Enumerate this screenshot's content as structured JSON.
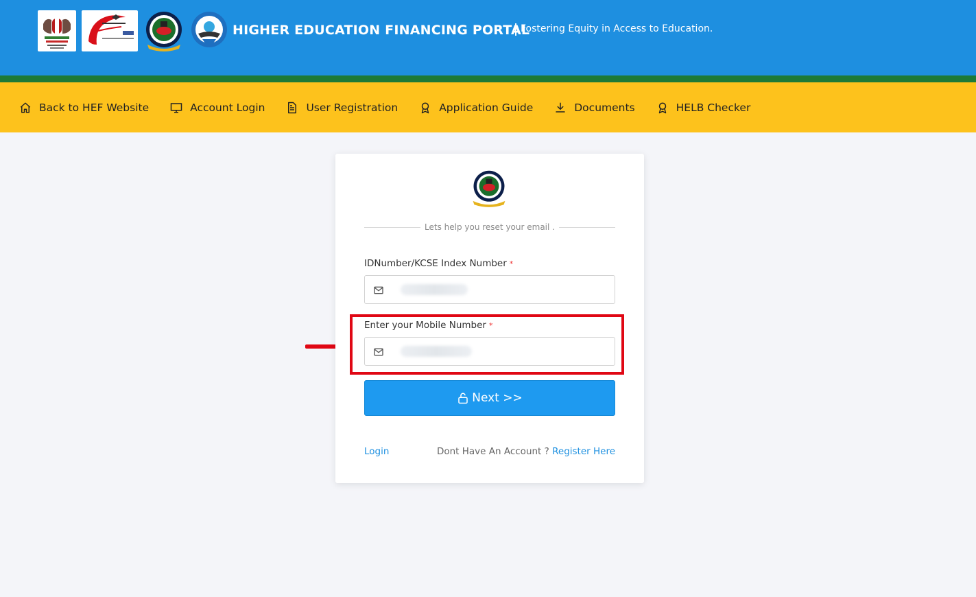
{
  "header": {
    "title": "HIGHER EDUCATION FINANCING PORTAL",
    "tagline": "Fostering Equity in Access to Education."
  },
  "nav": {
    "items": [
      {
        "label": "Back to HEF Website",
        "icon": "home-icon"
      },
      {
        "label": "Account Login",
        "icon": "monitor-icon"
      },
      {
        "label": "User Registration",
        "icon": "document-icon"
      },
      {
        "label": "Application Guide",
        "icon": "award-icon"
      },
      {
        "label": "Documents",
        "icon": "download-icon"
      },
      {
        "label": "HELB Checker",
        "icon": "award-icon"
      }
    ]
  },
  "form": {
    "subtitle": "Lets help you reset your email .",
    "id_label": "IDNumber/KCSE Index Number",
    "mobile_label": "Enter your Mobile Number",
    "required_mark": "*",
    "next_label": "Next >>",
    "login_link": "Login",
    "no_account_text": "Dont Have An Account ?",
    "register_link": "Register Here"
  },
  "colors": {
    "header_blue": "#1e8fe0",
    "nav_yellow": "#fdc21c",
    "green_strip": "#1d7a37",
    "button_blue": "#1e9af0",
    "highlight_red": "#e00714"
  }
}
